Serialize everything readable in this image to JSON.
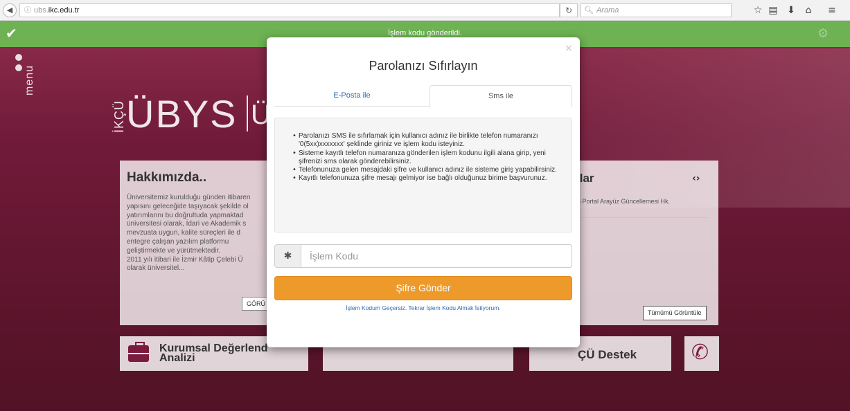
{
  "browser": {
    "back_icon": "arrow-left-icon",
    "info_icon": "info-icon",
    "url_subdomain": "ubs.",
    "url_host": "ikc.edu.tr",
    "reload_icon": "reload-icon",
    "search_placeholder": "Arama",
    "toolbar_icons": [
      "star-icon",
      "library-icon",
      "download-icon",
      "home-icon",
      "menu-icon"
    ]
  },
  "notification": {
    "icon": "check-icon",
    "message": "İşlem kodu gönderildi."
  },
  "side_menu": {
    "label": "menu"
  },
  "logo": {
    "small": "İKÇÜ",
    "main": "ÜBYS",
    "suffix": "Ü"
  },
  "about": {
    "title": "Hakkımızda..",
    "text": "Üniversitemiz kurulduğu günden itibaren\nyapısını geleceğide taşıyacak şekilde ol\nyatırımlarını bu doğrultuda yapmaktad\nüniversitesi olarak, İdari ve Akademik s\nmevzuata uygun, kalite süreçleri ile d\nentegre çalışan yazılım platformu\ngeliştirmekte ve yürütmektedir.\n2011 yılı itibari ile İzmir Kâtip Çelebi Ü\nolarak üniversitel...",
    "more_label": "GÖRÜ"
  },
  "announcements": {
    "title": "ılar",
    "item": "S Portal Arayüz Güncellemesi Hk.",
    "all_label": "Tümümü Görüntüle"
  },
  "tiles": {
    "kurumsal_line1": "Kurumsal Değerlend",
    "kurumsal_line2": "Analizi",
    "destek": "ÇÜ Destek"
  },
  "modal": {
    "title": "Parolanızı Sıfırlayın",
    "tabs": [
      {
        "label": "E-Posta ile",
        "active": false
      },
      {
        "label": "Sms ile",
        "active": true
      }
    ],
    "info": [
      "Parolanızı SMS ile sıfırlamak için kullanıcı adınız ile birlikte telefon numaranızı '0(5xx)xxxxxxx' şeklinde giriniz ve işlem kodu isteyiniz.",
      "Sisteme kayıtlı telefon numaranıza gönderilen işlem kodunu ilgili alana girip, yeni şifrenizi sms olarak gönderebilirsiniz.",
      "Telefonunuza gelen mesajdaki şifre ve kullanıcı adınız ile sisteme giriş yapabilirsiniz.",
      "Kayıtlı telefonunuza şifre mesajı gelmiyor ise bağlı olduğunuz birime başvurunuz."
    ],
    "code_icon": "asterisk-icon",
    "code_placeholder": "İşlem Kodu",
    "code_value": "",
    "send_label": "Şifre Gönder",
    "retry_label": "İşlem Kodum Geçersiz. Tekrar İşlem Kodu Almak İstiyorum."
  },
  "colors": {
    "notify_green": "#6eb253",
    "send_orange": "#ee9a2a",
    "link_blue": "#2a6ab0",
    "brand_maroon": "#7a1b3e"
  }
}
